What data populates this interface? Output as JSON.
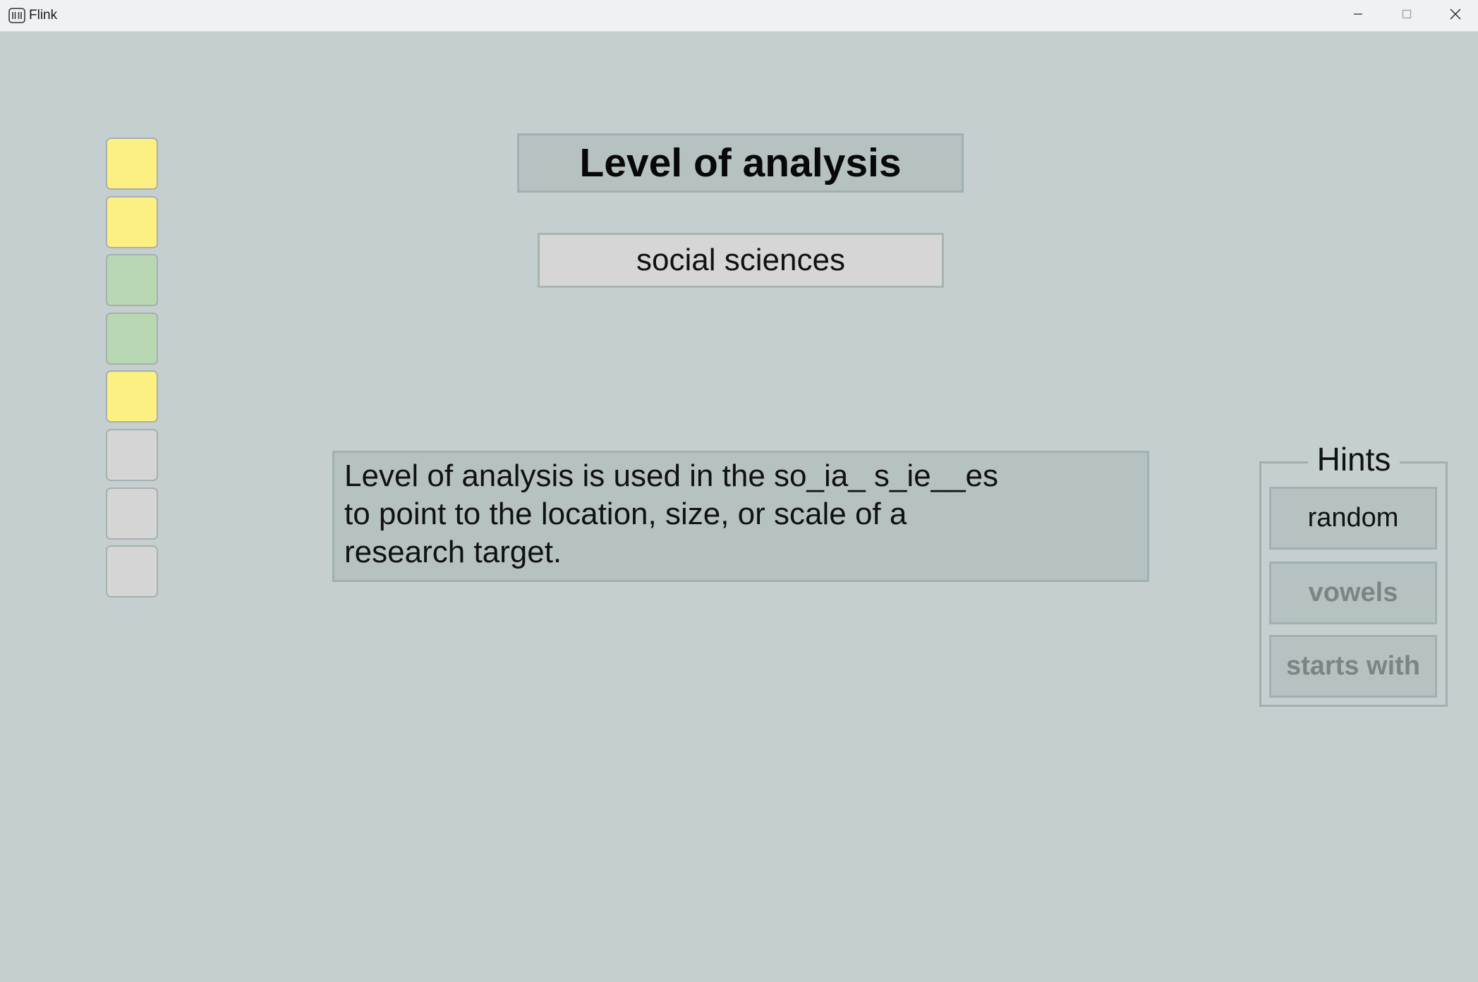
{
  "window": {
    "title": "Flink"
  },
  "progress": {
    "boxes": [
      {
        "status": "yellow"
      },
      {
        "status": "yellow"
      },
      {
        "status": "green"
      },
      {
        "status": "green"
      },
      {
        "status": "yellow"
      },
      {
        "status": "empty"
      },
      {
        "status": "empty"
      },
      {
        "status": "empty"
      }
    ]
  },
  "card": {
    "term": "Level of analysis",
    "category": "social sciences",
    "definition": "Level of analysis is used in the so_ia_ s_ie__es\nto point to the location, size, or scale of a\nresearch target."
  },
  "hints": {
    "title": "Hints",
    "buttons": [
      {
        "label": "random",
        "enabled": true
      },
      {
        "label": "vowels",
        "enabled": false
      },
      {
        "label": "starts with",
        "enabled": false
      }
    ]
  },
  "colors": {
    "background": "#c5cfcf",
    "yellow": "#fdf082",
    "green": "#b8d8b4",
    "empty": "#d5d5d5"
  }
}
